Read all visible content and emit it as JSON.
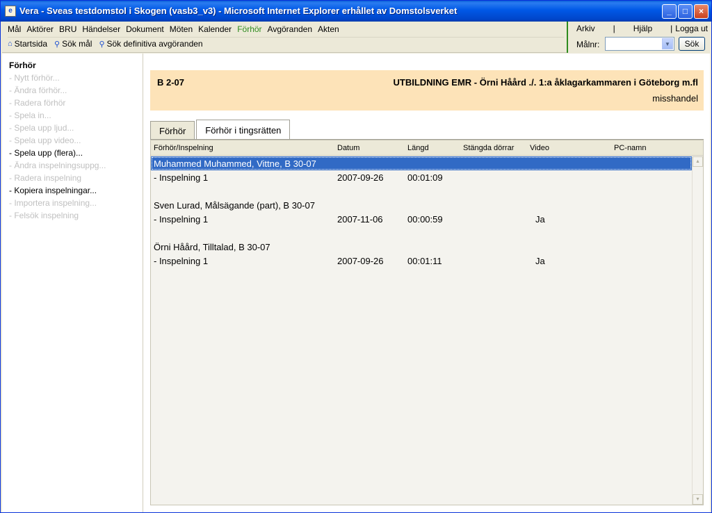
{
  "window": {
    "title": "Vera - Sveas testdomstol i Skogen (vasb3_v3) - Microsoft Internet Explorer erhållet av Domstolsverket",
    "minimize": "_",
    "maximize": "□",
    "close": "×"
  },
  "menu": [
    "Mål",
    "Aktörer",
    "BRU",
    "Händelser",
    "Dokument",
    "Möten",
    "Kalender",
    "Förhör",
    "Avgöranden",
    "Akten"
  ],
  "quick_links": [
    "Startsida",
    "Sök mål",
    "Sök definitiva avgöranden"
  ],
  "right_panel": {
    "links": [
      "Arkiv",
      "|",
      "Hjälp",
      "|",
      "Logga ut"
    ],
    "malnr_label": "Målnr:",
    "search_button": "Sök"
  },
  "sidebar": {
    "title": "Förhör",
    "items": [
      {
        "label": "- Nytt förhör...",
        "enabled": false
      },
      {
        "label": "- Ändra förhör...",
        "enabled": false
      },
      {
        "label": "- Radera förhör",
        "enabled": false
      },
      {
        "label": "- Spela in...",
        "enabled": false
      },
      {
        "label": "- Spela upp ljud...",
        "enabled": false
      },
      {
        "label": "- Spela upp video...",
        "enabled": false
      },
      {
        "label": "- Spela upp (flera)...",
        "enabled": true
      },
      {
        "label": "- Ändra inspelningsuppg...",
        "enabled": false
      },
      {
        "label": "- Radera inspelning",
        "enabled": false
      },
      {
        "label": "- Kopiera inspelningar...",
        "enabled": true
      },
      {
        "label": "- Importera inspelning...",
        "enabled": false
      },
      {
        "label": "- Felsök inspelning",
        "enabled": false
      }
    ]
  },
  "case": {
    "number": "B 2-07",
    "title": "UTBILDNING EMR - Örni Håård ./. 1:a åklagarkammaren i Göteborg m.fl",
    "type": "misshandel"
  },
  "tabs": [
    {
      "label": "Förhör",
      "selected": false
    },
    {
      "label": "Förhör i tingsrätten",
      "selected": true
    }
  ],
  "table": {
    "columns": [
      "Förhör/Inspelning",
      "Datum",
      "Längd",
      "Stängda dörrar",
      "Video",
      "PC-namn"
    ],
    "groups": [
      {
        "name": "Muhammed Muhammed, Vittne, B 30-07",
        "selected": true,
        "recordings": [
          {
            "name": "- Inspelning 1",
            "date": "2007-09-26",
            "length": "00:01:09",
            "closed": "",
            "video": "",
            "pc": ""
          }
        ]
      },
      {
        "name": "Sven Lurad, Målsägande (part), B 30-07",
        "selected": false,
        "recordings": [
          {
            "name": "- Inspelning 1",
            "date": "2007-11-06",
            "length": "00:00:59",
            "closed": "",
            "video": "Ja",
            "pc": ""
          }
        ]
      },
      {
        "name": "Örni Håård, Tilltalad, B 30-07",
        "selected": false,
        "recordings": [
          {
            "name": "- Inspelning 1",
            "date": "2007-09-26",
            "length": "00:01:11",
            "closed": "",
            "video": "Ja",
            "pc": ""
          }
        ]
      }
    ]
  },
  "colors": {
    "active_menu": "#2e8b1e",
    "selection": "#316ac5",
    "case_header_bg": "#fde3b8",
    "disabled_text": "#c0c0c0"
  }
}
